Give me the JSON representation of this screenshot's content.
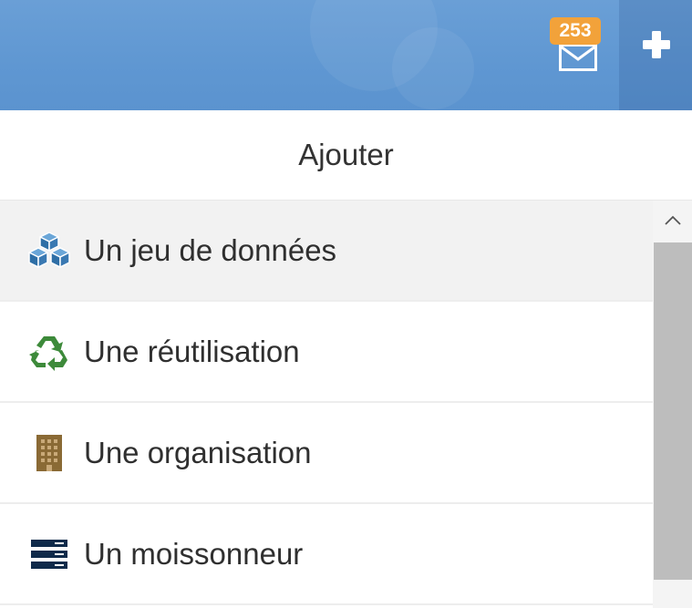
{
  "header": {
    "notifications": {
      "count": "253",
      "icon": "envelope-icon",
      "badge_color": "#f2a23a"
    },
    "add_button": {
      "icon": "plus-icon"
    },
    "bar_color": "#5f97d2"
  },
  "dropdown": {
    "title": "Ajouter",
    "items": [
      {
        "label": "Un jeu de données",
        "icon": "cubes-icon",
        "color": "#3a79b2",
        "active": true
      },
      {
        "label": "Une réutilisation",
        "icon": "recycle-icon",
        "color": "#3d8a3a",
        "active": false
      },
      {
        "label": "Une organisation",
        "icon": "building-icon",
        "color": "#8a6a35",
        "active": false
      },
      {
        "label": "Un moissonneur",
        "icon": "server-icon",
        "color": "#0f2a4a",
        "active": false
      }
    ]
  }
}
